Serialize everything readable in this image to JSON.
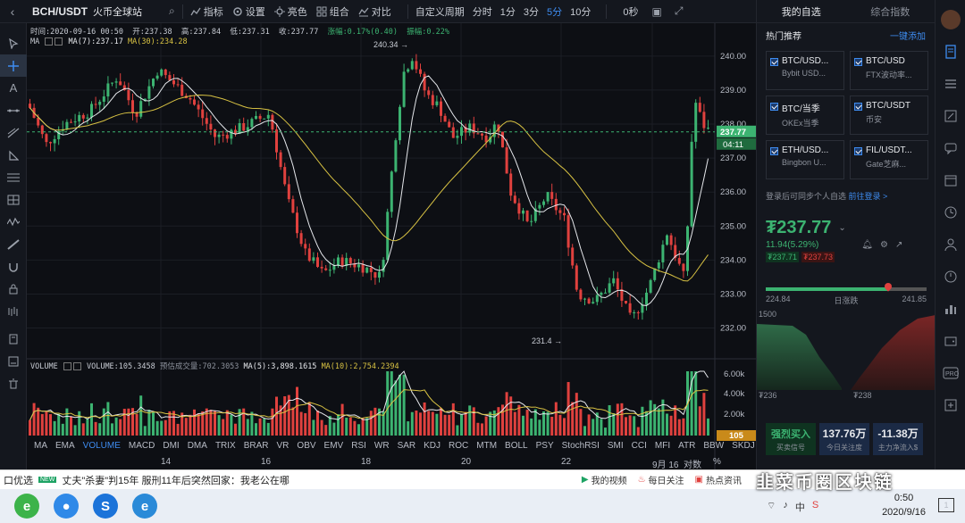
{
  "topbar": {
    "symbol": "BCH/USDT",
    "exchange": "火币全球站",
    "tools": [
      "指标",
      "设置",
      "亮色",
      "组合",
      "对比"
    ],
    "custom_period": "自定义周期",
    "periods": [
      "分时",
      "1分",
      "3分",
      "5分",
      "10分"
    ],
    "active_period": "5分",
    "countdown": "0秒"
  },
  "infobar": {
    "time": "时间:2020-09-16 00:50",
    "open": "开:237.38",
    "high": "高:237.84",
    "low": "低:237.31",
    "close": "收:237.77",
    "change": "涨幅:0.17%(0.40)",
    "amplitude": "振幅:0.22%"
  },
  "ma_legend": {
    "name": "MA",
    "ma7": "MA(7):237.17",
    "ma30": "MA(30):234.28"
  },
  "volume_legend": {
    "name": "VOLUME",
    "volume": "VOLUME:105.3458",
    "est": "预估成交量:702.3053",
    "ma5": "MA(5):3,898.1615",
    "ma10": "MA(10):2,754.2394"
  },
  "price_axis": {
    "labels": [
      "240.00",
      "239.00",
      "238.00",
      "237.00",
      "236.00",
      "235.00",
      "234.00",
      "233.00",
      "232.00"
    ],
    "current": "237.77",
    "countdown": "04:11",
    "vol_labels": [
      "6.00k",
      "4.00k",
      "2.00k"
    ],
    "vol_current": "105"
  },
  "annotations": {
    "high": "240.34",
    "low": "231.4"
  },
  "indicators": [
    "MA",
    "EMA",
    "VOLUME",
    "MACD",
    "DMI",
    "DMA",
    "TRIX",
    "BRAR",
    "VR",
    "OBV",
    "EMV",
    "RSI",
    "WR",
    "SAR",
    "KDJ",
    "ROC",
    "MTM",
    "BOLL",
    "PSY",
    "StochRSI",
    "SMI",
    "CCI",
    "MFI",
    "ATR",
    "BBW",
    "SKDJ",
    "BIAS"
  ],
  "active_indicator": "VOLUME",
  "date_axis": {
    "labels": [
      "14",
      "16",
      "18",
      "20",
      "22",
      "9月 16"
    ],
    "log_label": "对数",
    "pct_label": "%"
  },
  "right_panel": {
    "tabs": [
      "我的自选",
      "综合指数"
    ],
    "hot_title": "热门推荐",
    "add_all": "一键添加",
    "cards": [
      {
        "pair": "BTC/USD...",
        "source": "Bybit USD..."
      },
      {
        "pair": "BTC/USD",
        "source": "FTX波动率..."
      },
      {
        "pair": "BTC/当季",
        "source": "OKEx当季"
      },
      {
        "pair": "BTC/USDT",
        "source": "币安"
      },
      {
        "pair": "ETH/USD...",
        "source": "Bingbon U..."
      },
      {
        "pair": "FIL/USDT...",
        "source": "Gate芝麻..."
      }
    ],
    "login_text": "登录后可同步个人自选",
    "login_link": "前往登录 >",
    "price": "₮237.77",
    "change": "11.94(5.29%)",
    "tag_low": "₮237.71",
    "tag_high": "₮237.73",
    "range_low": "224.84",
    "range_label": "日涨跌",
    "range_high": "241.85",
    "range_position": 0.76,
    "depth_label_top": "1500",
    "depth_left": "₮236",
    "depth_right": "₮238",
    "buttons": [
      {
        "value": "强烈买入",
        "sub": "买卖信号"
      },
      {
        "value": "137.76万",
        "sub": "今日关注度"
      },
      {
        "value": "-11.38万",
        "sub": "主力净流入$"
      }
    ]
  },
  "browser": {
    "left": "口优选",
    "news": "丈夫\"杀妻\"判15年 服刑11年后突然回家：我老公在哪",
    "links": [
      "我的视频",
      "每日关注",
      "热点资讯"
    ]
  },
  "taskbar": {
    "time": "0:50",
    "date": "2020/9/16"
  },
  "watermark": "韭菜币圈区块链",
  "colors": {
    "up": "#3cb371",
    "down": "#e0413e",
    "accent": "#3e8cf0",
    "ma7": "#e6e8ec",
    "ma30": "#d8c243"
  },
  "chart_data": {
    "type": "candlestick",
    "price_range": [
      231.2,
      240.6
    ],
    "x": [
      "14",
      "16",
      "18",
      "20",
      "22",
      "9月 16"
    ],
    "volume_ticks": [
      "6.00k",
      "4.00k",
      "2.00k"
    ]
  }
}
